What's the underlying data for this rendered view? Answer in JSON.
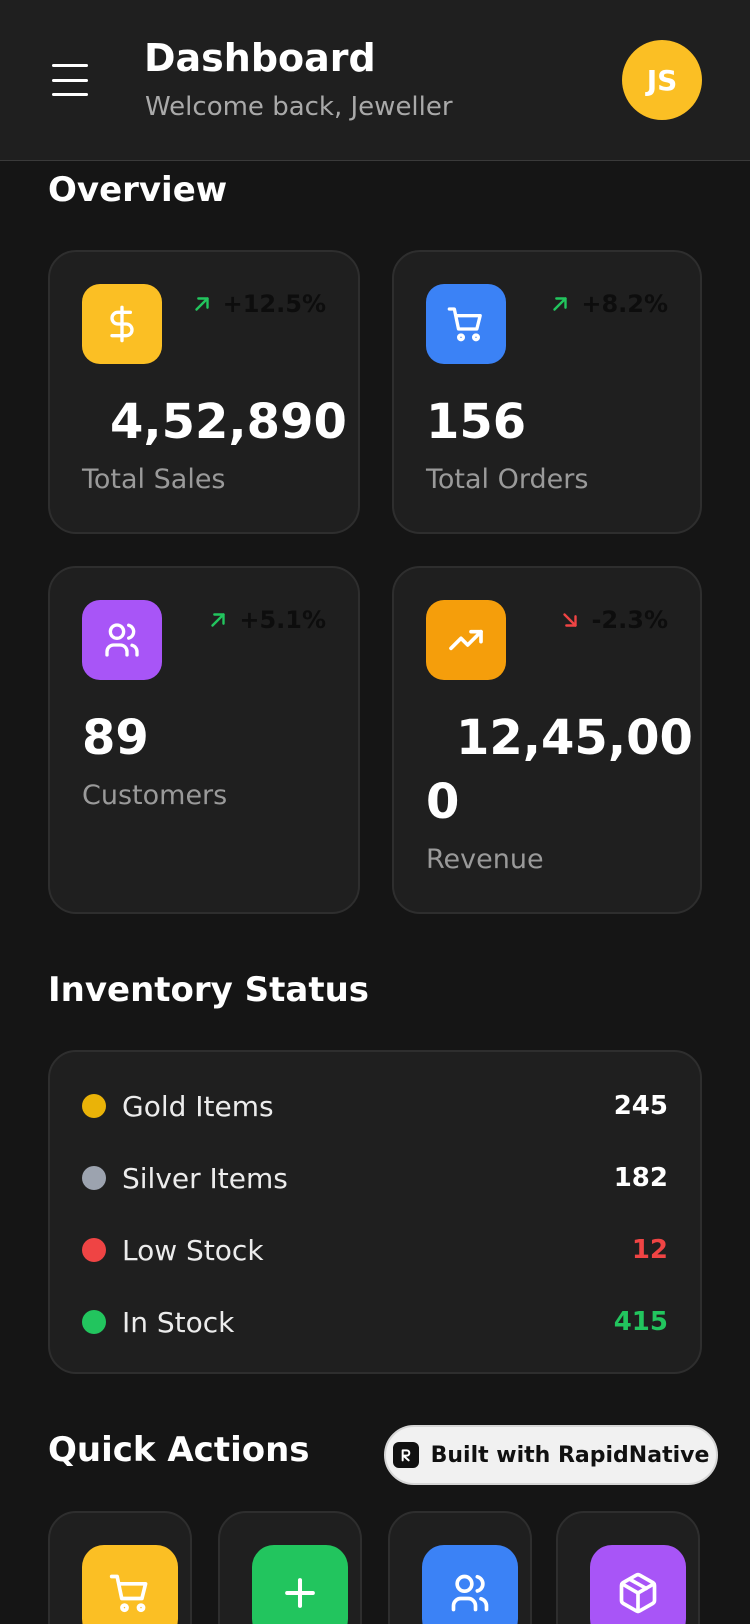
{
  "header": {
    "title": "Dashboard",
    "subtitle": "Welcome back, Jeweller",
    "avatar_initials": "JS"
  },
  "overview": {
    "title": "Overview",
    "cards": [
      {
        "label": "Total Sales",
        "value": "4,52,890",
        "trend": "+12.5%",
        "direction": "up",
        "icon": "dollar-icon",
        "color": "#fbbf24"
      },
      {
        "label": "Total Orders",
        "value": "156",
        "trend": "+8.2%",
        "direction": "up",
        "icon": "cart-icon",
        "color": "#3b82f6"
      },
      {
        "label": "Customers",
        "value": "89",
        "trend": "+5.1%",
        "direction": "up",
        "icon": "users-icon",
        "color": "#a855f7"
      },
      {
        "label": "Revenue",
        "value_line1": "12,45,00",
        "value_line2": "0",
        "trend": "-2.3%",
        "direction": "down",
        "icon": "trending-up-icon",
        "color": "#f59e0b"
      }
    ]
  },
  "inventory": {
    "title": "Inventory Status",
    "items": [
      {
        "label": "Gold Items",
        "value": "245",
        "dot_color": "#eab308",
        "value_color": "#ffffff"
      },
      {
        "label": "Silver Items",
        "value": "182",
        "dot_color": "#9ca3af",
        "value_color": "#ffffff"
      },
      {
        "label": "Low Stock",
        "value": "12",
        "dot_color": "#ef4444",
        "value_color": "#ef4444"
      },
      {
        "label": "In Stock",
        "value": "415",
        "dot_color": "#22c55e",
        "value_color": "#22c55e"
      }
    ]
  },
  "quick_actions": {
    "title": "Quick Actions",
    "items": [
      {
        "icon": "cart-icon",
        "color": "#fbbf24"
      },
      {
        "icon": "plus-icon",
        "color": "#22c55e"
      },
      {
        "icon": "users-icon",
        "color": "#3b82f6"
      },
      {
        "icon": "package-icon",
        "color": "#a855f7"
      }
    ]
  },
  "badge": {
    "label": "Built with RapidNative"
  },
  "colors": {
    "trend_up": "#22c55e",
    "trend_down": "#ef4444"
  }
}
